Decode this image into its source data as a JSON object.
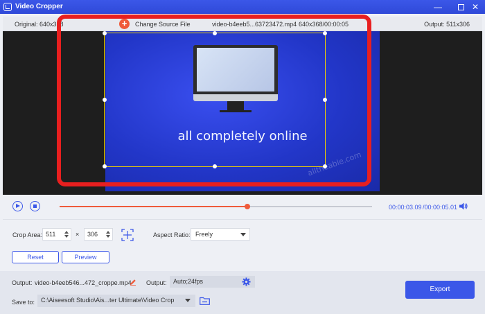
{
  "window": {
    "title": "Video Cropper"
  },
  "info": {
    "original": "Original: 640x368",
    "change_source": "Change Source File",
    "filename": "video-b4eeb5...63723472.mp4",
    "meta": "640x368/00:00:05",
    "output": "Output: 511x306"
  },
  "video": {
    "caption": "all completely online",
    "watermark": "alltheable.com"
  },
  "player": {
    "current_time": "00:00:03.09",
    "total_time": "/00:00:05.01",
    "progress": 0.6
  },
  "crop": {
    "label": "Crop Area:",
    "width": "511",
    "times": "×",
    "height": "306",
    "aspect_label": "Aspect Ratio:",
    "aspect_value": "Freely",
    "reset": "Reset",
    "preview": "Preview"
  },
  "output": {
    "label": "Output:",
    "filename": "video-b4eeb546...472_croppe.mp4",
    "settings_label": "Output:",
    "settings_value": "Auto;24fps"
  },
  "save": {
    "label": "Save to:",
    "path": "C:\\Aiseesoft Studio\\Ais...ter Ultimate\\Video Crop"
  },
  "export": "Export",
  "colors": {
    "accent": "#3b57e8",
    "progress": "#ef5a3a",
    "annotation": "#e81f1f",
    "crop_border": "#f0d000"
  }
}
